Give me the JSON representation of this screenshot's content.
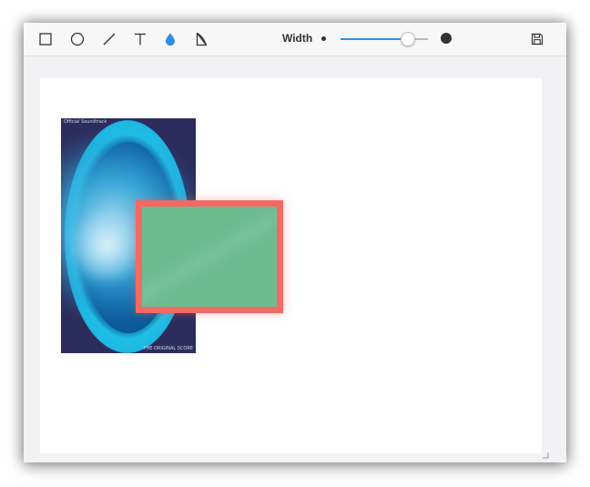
{
  "toolbar": {
    "tools": [
      {
        "name": "rectangle-tool",
        "icon": "square-icon",
        "active": false
      },
      {
        "name": "ellipse-tool",
        "icon": "circle-icon",
        "active": false
      },
      {
        "name": "line-tool",
        "icon": "line-icon",
        "active": false
      },
      {
        "name": "text-tool",
        "icon": "text-icon",
        "active": false
      },
      {
        "name": "blur-tool",
        "icon": "drop-icon",
        "active": true
      },
      {
        "name": "crop-tool",
        "icon": "crop-icon",
        "active": false
      }
    ],
    "width_label": "Width",
    "width_value": 0.82,
    "save_icon": "save-icon",
    "accent_color": "#2d8fe6"
  },
  "canvas": {
    "image_text_top": "Official Soundtrack",
    "image_text_bottom": "THE ORIGINAL SCORE",
    "shape_fill_color": "#6cbb8f",
    "shape_stroke_color": "#f26a63"
  }
}
